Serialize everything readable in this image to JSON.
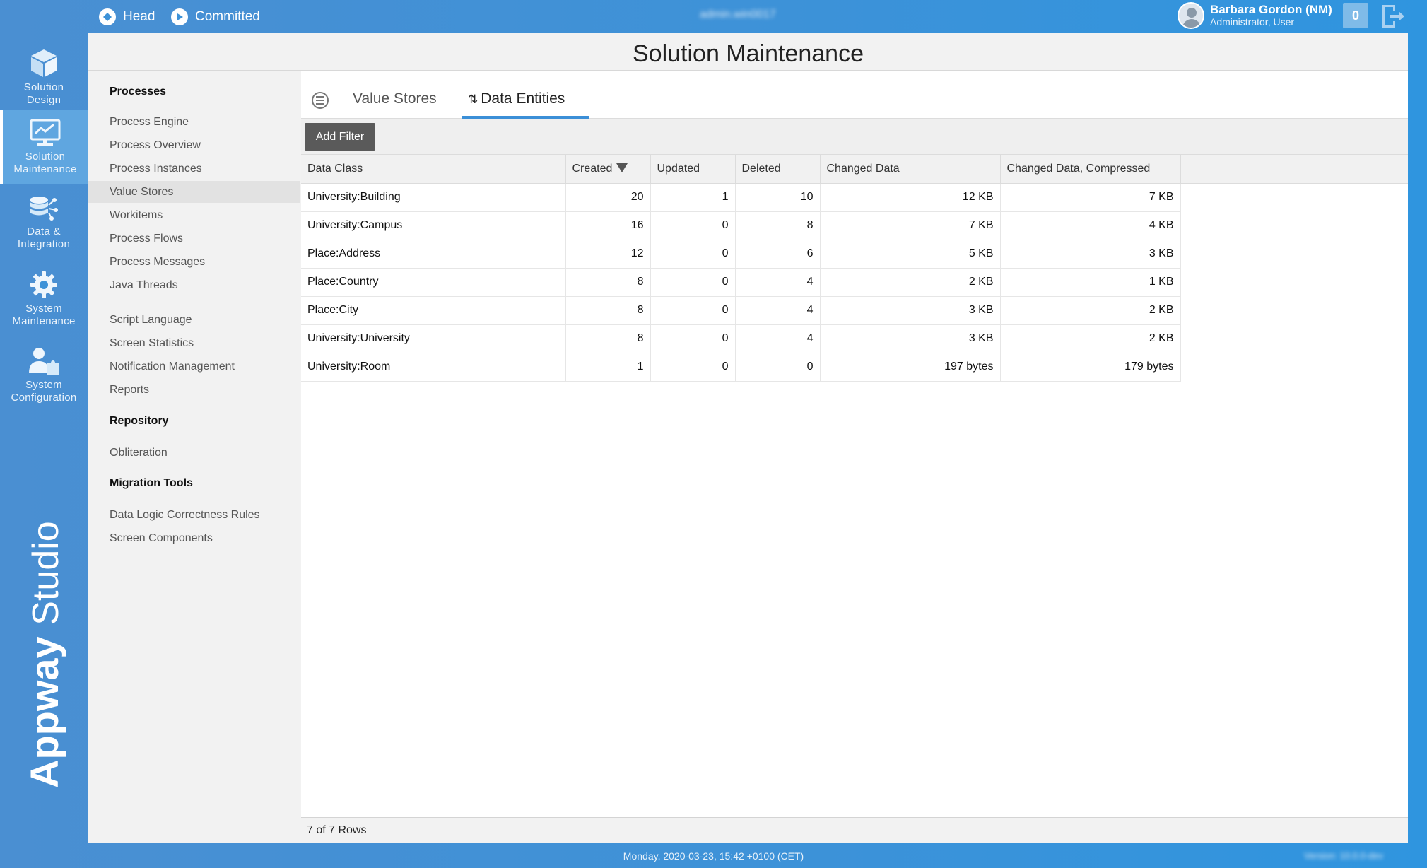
{
  "topbar": {
    "head_label": "Head",
    "committed_label": "Committed",
    "center_hidden_text": "admin.win0017",
    "user_name": "Barbara Gordon (NM)",
    "user_role": "Administrator, User",
    "notification_count": "0"
  },
  "nav": {
    "items": [
      {
        "label1": "Solution",
        "label2": "Design",
        "icon": "cube-icon"
      },
      {
        "label1": "Solution",
        "label2": "Maintenance",
        "icon": "monitor-chart-icon"
      },
      {
        "label1": "Data &",
        "label2": "Integration",
        "icon": "database-network-icon"
      },
      {
        "label1": "System",
        "label2": "Maintenance",
        "icon": "gear-icon"
      },
      {
        "label1": "System",
        "label2": "Configuration",
        "icon": "user-puzzle-icon"
      }
    ],
    "active_index": 1
  },
  "brand": {
    "bold": "Appway",
    "light": "Studio"
  },
  "page": {
    "title": "Solution Maintenance"
  },
  "sidebar": {
    "sections": [
      {
        "title": "Processes",
        "items": [
          "Process Engine",
          "Process Overview",
          "Process Instances",
          "Value Stores",
          "Workitems",
          "Process Flows",
          "Process Messages",
          "Java Threads",
          "Script Language",
          "Screen Statistics",
          "Notification Management",
          "Reports"
        ]
      },
      {
        "title": "Repository",
        "items": [
          "Obliteration"
        ]
      },
      {
        "title": "Migration Tools",
        "items": [
          "Data Logic Correctness Rules",
          "Screen Components"
        ]
      }
    ],
    "selected": "Value Stores"
  },
  "tabs": {
    "items": [
      "Value Stores",
      "Data Entities"
    ],
    "active": "Data Entities"
  },
  "toolbar": {
    "add_filter_label": "Add Filter"
  },
  "table": {
    "columns": [
      "Data Class",
      "Created",
      "Updated",
      "Deleted",
      "Changed Data",
      "Changed Data, Compressed"
    ],
    "sorted_column": "Created",
    "sort_direction": "descending",
    "rows": [
      [
        "University:Building",
        "20",
        "1",
        "10",
        "12 KB",
        "7 KB"
      ],
      [
        "University:Campus",
        "16",
        "0",
        "8",
        "7 KB",
        "4 KB"
      ],
      [
        "Place:Address",
        "12",
        "0",
        "6",
        "5 KB",
        "3 KB"
      ],
      [
        "Place:Country",
        "8",
        "0",
        "4",
        "2 KB",
        "1 KB"
      ],
      [
        "Place:City",
        "8",
        "0",
        "4",
        "3 KB",
        "2 KB"
      ],
      [
        "University:University",
        "8",
        "0",
        "4",
        "3 KB",
        "2 KB"
      ],
      [
        "University:Room",
        "1",
        "0",
        "0",
        "197 bytes",
        "179 bytes"
      ]
    ],
    "row_count_text": "7 of 7 Rows"
  },
  "status": {
    "datetime": "Monday, 2020-03-23, 15:42 +0100 (CET)",
    "version_hidden": "Version: 10.0.0-dev"
  },
  "colors": {
    "accent": "#3b8fd7",
    "chrome": "#3d92d8",
    "button": "#5a5a5a"
  }
}
